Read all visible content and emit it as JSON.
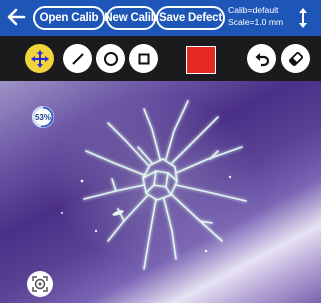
{
  "header": {
    "back_icon": "arrow-left-icon",
    "open_calib_label": "Open Calib",
    "new_calib_label": "New Calib",
    "save_defect_label": "Save Defect",
    "calib_line": "Calib=default",
    "scale_line": "Scale=1.0 mm",
    "sort_icon": "sort-arrows-icon"
  },
  "toolbar": {
    "tools": [
      "move-arrows-icon",
      "line-tool-icon",
      "circle-tool-icon",
      "square-tool-icon"
    ],
    "active_tool": "move-arrows-icon",
    "color": "#e52924",
    "undo_icon": "undo-icon",
    "eraser_icon": "eraser-icon"
  },
  "canvas": {
    "progress_text": "53%",
    "progress_value": 0.53,
    "locate_icon": "locate-target-icon"
  },
  "colors": {
    "header_bg": "#1e56b8",
    "toolbar_bg": "#1b1a1d",
    "pan_tool_bg": "#f1d43a"
  }
}
